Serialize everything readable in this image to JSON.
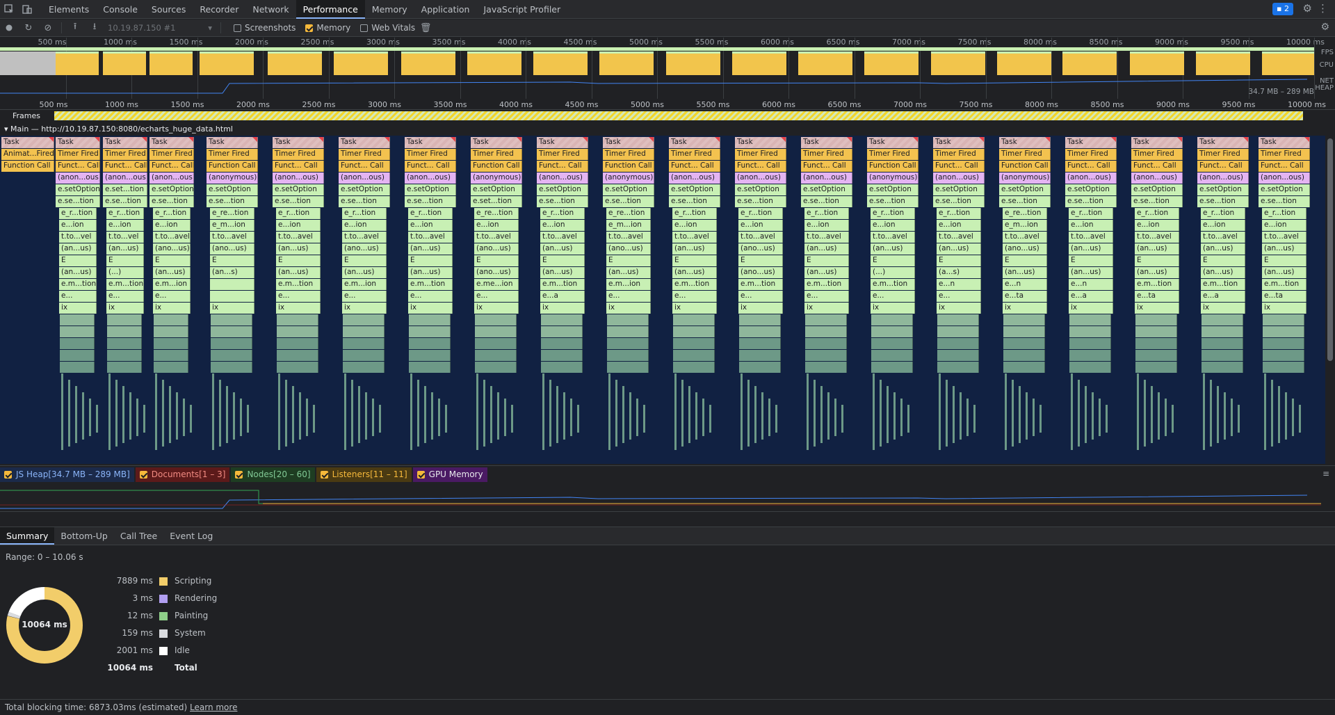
{
  "tabs": {
    "items": [
      "Elements",
      "Console",
      "Sources",
      "Recorder",
      "Network",
      "Performance",
      "Memory",
      "Application",
      "JavaScript Profiler"
    ],
    "active": "Performance",
    "issues_count": "2"
  },
  "toolbar": {
    "recording_select": "10.19.87.150 #1",
    "screenshots_label": "Screenshots",
    "memory_label": "Memory",
    "webvitals_label": "Web Vitals"
  },
  "overview": {
    "ticks": [
      "500 ms",
      "1000 ms",
      "1500 ms",
      "2000 ms",
      "2500 ms",
      "3000 ms",
      "3500 ms",
      "4000 ms",
      "4500 ms",
      "5000 ms",
      "5500 ms",
      "6000 ms",
      "6500 ms",
      "7000 ms",
      "7500 ms",
      "8000 ms",
      "8500 ms",
      "9000 ms",
      "9500 ms",
      "10000 ms"
    ],
    "fps_label": "FPS",
    "cpu_label": "CPU",
    "net_label": "NET",
    "heap_label": "HEAP",
    "heap_range": "34.7 MB – 289 MB"
  },
  "timeline": {
    "ticks": [
      "500 ms",
      "1000 ms",
      "1500 ms",
      "2000 ms",
      "2500 ms",
      "3000 ms",
      "3500 ms",
      "4000 ms",
      "4500 ms",
      "5000 ms",
      "5500 ms",
      "6000 ms",
      "6500 ms",
      "7000 ms",
      "7500 ms",
      "8000 ms",
      "8500 ms",
      "9000 ms",
      "9500 ms",
      "10000 ms"
    ],
    "frames_label": "Frames",
    "main_label": "Main — http://10.19.87.150:8080/echarts_huge_data.html"
  },
  "flame": {
    "first": [
      "Task",
      "Animat...Fired",
      "Function Call"
    ],
    "groups": [
      {
        "rows": [
          "Task",
          "Timer Fired",
          "Funct... Call",
          "(anon...ous)",
          "e.setOption",
          "e.se...tion",
          "e_r...tion",
          "e...ion",
          "t.to...vel",
          "(an...us)",
          "E",
          "(an...us)",
          "e.m...tion",
          "e...",
          "ix"
        ]
      },
      {
        "rows": [
          "Task",
          "Timer Fired",
          "Funct... Call",
          "(anon...ous)",
          "e.set...tion",
          "e.se...tion",
          "e_r...tion",
          "e...ion",
          "t.to...vel",
          "(an...us)",
          "E",
          "(...)",
          "e.m...tion",
          "e...",
          "ix"
        ]
      },
      {
        "rows": [
          "Task",
          "Timer Fired",
          "Funct... Call",
          "(anon...ous)",
          "e.setOption",
          "e.se...tion",
          "e_r...tion",
          "e...ion",
          "t.to...avel",
          "(ano...us)",
          "E",
          "(an...us)",
          "e.m...ion",
          "e...",
          "ix"
        ]
      },
      {
        "rows": [
          "Task",
          "Timer Fired",
          "Function Call",
          "(anonymous)",
          "e.setOption",
          "e.se...tion",
          "e_re...tion",
          "e_m...ion",
          "t.to...avel",
          "(ano...us)",
          "E",
          "(an...s)",
          "",
          "",
          "ix"
        ]
      },
      {
        "rows": [
          "Task",
          "Timer Fired",
          "Funct... Call",
          "(anon...ous)",
          "e.setOption",
          "e.se...tion",
          "e_r...tion",
          "e...ion",
          "t.to...avel",
          "(an...us)",
          "E",
          "(an...us)",
          "e.m...tion",
          "e...",
          "ix"
        ]
      },
      {
        "rows": [
          "Task",
          "Timer Fired",
          "Funct... Call",
          "(anon...ous)",
          "e.setOption",
          "e.se...tion",
          "e_r...tion",
          "e...ion",
          "t.to...avel",
          "(ano...us)",
          "E",
          "(an...us)",
          "e.m...ion",
          "e...",
          "ix"
        ]
      },
      {
        "rows": [
          "Task",
          "Timer Fired",
          "Funct... Call",
          "(anon...ous)",
          "e.setOption",
          "e.se...tion",
          "e_r...tion",
          "e...ion",
          "t.to...avel",
          "(an...us)",
          "E",
          "(an...us)",
          "e.m...tion",
          "e...",
          "ix"
        ]
      },
      {
        "rows": [
          "Task",
          "Timer Fired",
          "Function Call",
          "(anonymous)",
          "e.setOption",
          "e.set...tion",
          "e_re...tion",
          "e...ion",
          "t.to...avel",
          "(ano...us)",
          "E",
          "(ano...us)",
          "e.me...ion",
          "e...",
          "ix"
        ]
      },
      {
        "rows": [
          "Task",
          "Timer Fired",
          "Funct... Call",
          "(anon...ous)",
          "e.setOption",
          "e.se...tion",
          "e_r...tion",
          "e...ion",
          "t.to...avel",
          "(an...us)",
          "E",
          "(an...us)",
          "e.m...tion",
          "e...a",
          "ix"
        ]
      },
      {
        "rows": [
          "Task",
          "Timer Fired",
          "Function Call",
          "(anonymous)",
          "e.setOption",
          "e.se...tion",
          "e_re...tion",
          "e_m...ion",
          "t.to...avel",
          "(ano...us)",
          "E",
          "(an...us)",
          "e.m...ion",
          "e...",
          "ix"
        ]
      },
      {
        "rows": [
          "Task",
          "Timer Fired",
          "Funct... Call",
          "(anon...ous)",
          "e.setOption",
          "e.se...tion",
          "e_r...tion",
          "e...ion",
          "t.to...avel",
          "(an...us)",
          "E",
          "(an...us)",
          "e.m...tion",
          "e...",
          "ix"
        ]
      },
      {
        "rows": [
          "Task",
          "Timer Fired",
          "Funct... Call",
          "(anon...ous)",
          "e.setOption",
          "e.se...tion",
          "e_r...tion",
          "e...ion",
          "t.to...avel",
          "(ano...us)",
          "E",
          "(ano...us)",
          "e.m...tion",
          "e...",
          "ix"
        ]
      },
      {
        "rows": [
          "Task",
          "Timer Fired",
          "Funct... Call",
          "(anon...ous)",
          "e.setOption",
          "e.se...tion",
          "e_r...tion",
          "e...ion",
          "t.to...avel",
          "(an...us)",
          "E",
          "(an...us)",
          "e.m...tion",
          "e...",
          "ix"
        ]
      },
      {
        "rows": [
          "Task",
          "Timer Fired",
          "Function Call",
          "(anonymous)",
          "e.setOption",
          "e.se...tion",
          "e_r...tion",
          "e...ion",
          "t.to...avel",
          "(an...us)",
          "E",
          "(...)",
          "e.m...tion",
          "e...",
          "ix"
        ]
      },
      {
        "rows": [
          "Task",
          "Timer Fired",
          "Funct... Call",
          "(anon...ous)",
          "e.setOption",
          "e.se...tion",
          "e_r...tion",
          "e...ion",
          "t.to...avel",
          "(an...us)",
          "E",
          "(a...s)",
          "e...n",
          "e...",
          "ix"
        ]
      },
      {
        "rows": [
          "Task",
          "Timer Fired",
          "Function Call",
          "(anonymous)",
          "e.setOption",
          "e.se...tion",
          "e_re...tion",
          "e_m...ion",
          "t.to...avel",
          "(ano...us)",
          "E",
          "(an...us)",
          "e...n",
          "e...ta",
          "ix"
        ]
      },
      {
        "rows": [
          "Task",
          "Timer Fired",
          "Funct... Call",
          "(anon...ous)",
          "e.setOption",
          "e.se...tion",
          "e_r...tion",
          "e...ion",
          "t.to...avel",
          "(an...us)",
          "E",
          "(an...us)",
          "e...n",
          "e...a",
          "ix"
        ]
      },
      {
        "rows": [
          "Task",
          "Timer Fired",
          "Funct... Call",
          "(anon...ous)",
          "e.setOption",
          "e.se...tion",
          "e_r...tion",
          "e...ion",
          "t.to...avel",
          "(an...us)",
          "E",
          "(an...us)",
          "e.m...tion",
          "e...ta",
          "ix"
        ]
      },
      {
        "rows": [
          "Task",
          "Timer Fired",
          "Funct... Call",
          "(anon...ous)",
          "e.setOption",
          "e.se...tion",
          "e_r...tion",
          "e...ion",
          "t.to...avel",
          "(an...us)",
          "E",
          "(an...us)",
          "e.m...tion",
          "e...a",
          "ix"
        ]
      },
      {
        "rows": [
          "Task",
          "Timer Fired",
          "Funct... Call",
          "(anon...ous)",
          "e.setOption",
          "e.se...tion",
          "e_r...tion",
          "e...ion",
          "t.to...avel",
          "(an...us)",
          "E",
          "(an...us)",
          "e.m...tion",
          "e...ta",
          "ix"
        ]
      }
    ]
  },
  "counters": {
    "js_heap": "JS Heap[34.7 MB – 289 MB]",
    "documents": "Documents[1 – 3]",
    "nodes": "Nodes[20 – 60]",
    "listeners": "Listeners[11 – 11]",
    "gpu": "GPU Memory",
    "colors": {
      "js_heap": "#4285f4",
      "documents": "#c5221f",
      "nodes": "#34a853",
      "listeners": "#f6b93b",
      "gpu": "#9334e6"
    }
  },
  "bottom": {
    "tabs": [
      "Summary",
      "Bottom-Up",
      "Call Tree",
      "Event Log"
    ],
    "active": "Summary",
    "range": "Range: 0 – 10.06 s",
    "donut_label": "10064 ms",
    "rows": [
      {
        "value": "7889 ms",
        "label": "Scripting",
        "color": "#f2cd6a"
      },
      {
        "value": "3 ms",
        "label": "Rendering",
        "color": "#b19ff1"
      },
      {
        "value": "12 ms",
        "label": "Painting",
        "color": "#8fcf8a"
      },
      {
        "value": "159 ms",
        "label": "System",
        "color": "#dadce0"
      },
      {
        "value": "2001 ms",
        "label": "Idle",
        "color": "#ffffff"
      }
    ],
    "total_value": "10064 ms",
    "total_label": "Total",
    "footer_text": "Total blocking time: 6873.03ms (estimated)",
    "learn_more": "Learn more"
  }
}
